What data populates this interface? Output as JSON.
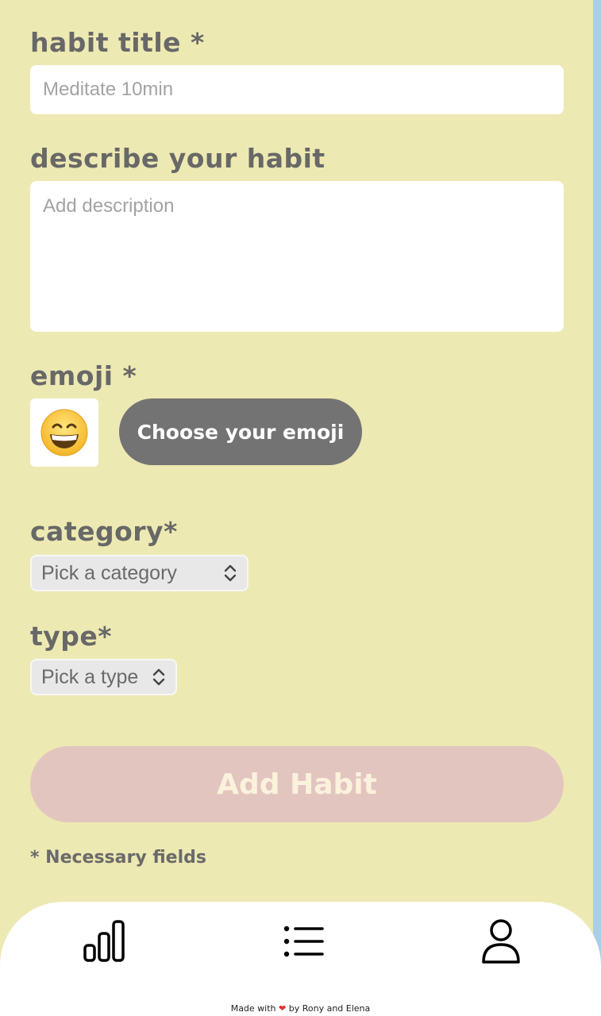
{
  "form": {
    "title_label": "habit title *",
    "title_placeholder": "Meditate 10min",
    "description_label": "describe your habit",
    "description_placeholder": "Add description",
    "emoji_label": "emoji *",
    "emoji_value": "😁",
    "emoji_button": "Choose your emoji",
    "category_label": "category*",
    "category_selected": "Pick a category",
    "type_label": "type*",
    "type_selected": "Pick a type",
    "submit_label": "Add Habit",
    "note": "* Necessary fields"
  },
  "nav": {
    "icons": [
      "bar-chart-icon",
      "list-icon",
      "user-icon"
    ]
  },
  "footer": {
    "prefix": "Made with",
    "heart": "❤",
    "suffix": "by Rony and Elena"
  },
  "colors": {
    "background": "#a9cfe6",
    "card": "#ede9b2",
    "label": "#686868",
    "emoji_button": "#737373",
    "submit_button": "#e3c5c0",
    "submit_text": "#fbf2dc"
  }
}
